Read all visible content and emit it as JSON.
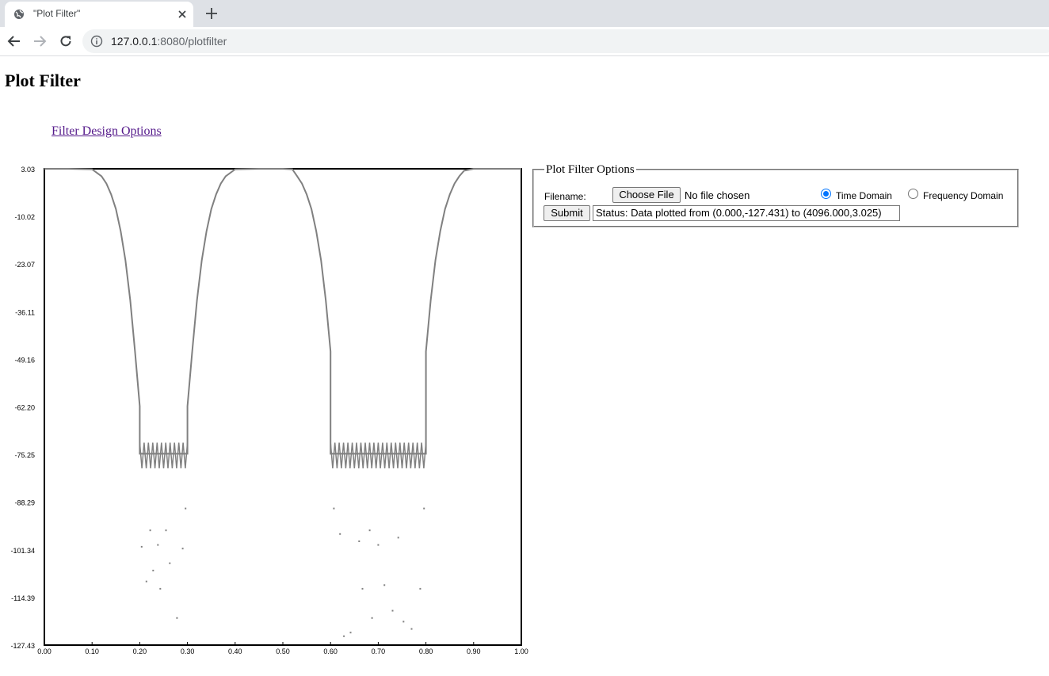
{
  "browser": {
    "tab_title": "\"Plot Filter\"",
    "url_host": "127.0.0.1",
    "url_rest": ":8080/plotfilter"
  },
  "page": {
    "title": "Plot Filter",
    "design_link": "Filter Design Options"
  },
  "options": {
    "legend": "Plot Filter Options",
    "filename_label": "Filename:",
    "choose_file_label": "Choose File",
    "no_file_text": "No file chosen",
    "time_domain_label": "Time Domain",
    "frequency_domain_label": "Frequency Domain",
    "selected_domain": "time",
    "submit_label": "Submit",
    "status_value": "Status: Data plotted from (0.000,-127.431) to (4096.000,3.025)"
  },
  "chart_data": {
    "type": "line",
    "xlim": [
      0.0,
      1.0
    ],
    "ylim": [
      -127.43,
      3.03
    ],
    "x_ticks": [
      "0.00",
      "0.10",
      "0.20",
      "0.30",
      "0.40",
      "0.50",
      "0.60",
      "0.70",
      "0.80",
      "0.90",
      "1.00"
    ],
    "y_ticks": [
      "3.03",
      "-10.02",
      "-23.07",
      "-36.11",
      "-49.16",
      "-62.20",
      "-75.25",
      "-88.29",
      "-101.34",
      "-114.39",
      "-127.43"
    ],
    "color": "#808080",
    "series": [
      {
        "x": [
          0.0,
          0.05,
          0.1,
          0.12,
          0.13,
          0.14,
          0.15,
          0.16,
          0.17,
          0.18,
          0.19,
          0.2,
          0.2,
          0.3,
          0.3,
          0.31,
          0.32,
          0.33,
          0.34,
          0.35,
          0.36,
          0.37,
          0.38,
          0.4,
          0.45,
          0.5,
          0.52,
          0.53,
          0.54,
          0.55,
          0.56,
          0.57,
          0.58,
          0.59,
          0.6,
          0.6,
          0.8,
          0.8,
          0.81,
          0.82,
          0.83,
          0.84,
          0.85,
          0.86,
          0.87,
          0.88,
          0.9,
          0.95,
          1.0
        ],
        "y": [
          3.03,
          3.03,
          2.9,
          1.0,
          -1.0,
          -4.0,
          -8.0,
          -14.0,
          -22.0,
          -33.0,
          -47.0,
          -62.0,
          -75.0,
          -75.0,
          -62.0,
          -47.0,
          -33.0,
          -22.0,
          -14.0,
          -8.0,
          -4.0,
          -1.0,
          1.0,
          2.9,
          3.03,
          3.03,
          2.9,
          1.0,
          -1.0,
          -4.0,
          -8.0,
          -14.0,
          -22.0,
          -33.0,
          -47.0,
          -75.0,
          -75.0,
          -47.0,
          -33.0,
          -22.0,
          -14.0,
          -8.0,
          -4.0,
          -1.0,
          1.0,
          2.5,
          3.03,
          3.03,
          3.03
        ]
      }
    ],
    "stopband_dips": [
      {
        "x": 0.204,
        "y": -100.5
      },
      {
        "x": 0.214,
        "y": -110.0
      },
      {
        "x": 0.222,
        "y": -96.0
      },
      {
        "x": 0.228,
        "y": -107.0
      },
      {
        "x": 0.238,
        "y": -100.0
      },
      {
        "x": 0.243,
        "y": -112.0
      },
      {
        "x": 0.255,
        "y": -96.0
      },
      {
        "x": 0.263,
        "y": -105.0
      },
      {
        "x": 0.278,
        "y": -120.0
      },
      {
        "x": 0.29,
        "y": -101.0
      },
      {
        "x": 0.296,
        "y": -90.0
      },
      {
        "x": 0.607,
        "y": -90.0
      },
      {
        "x": 0.62,
        "y": -97.0
      },
      {
        "x": 0.628,
        "y": -125.0
      },
      {
        "x": 0.642,
        "y": -124.0
      },
      {
        "x": 0.66,
        "y": -99.0
      },
      {
        "x": 0.667,
        "y": -112.0
      },
      {
        "x": 0.682,
        "y": -96.0
      },
      {
        "x": 0.687,
        "y": -120.0
      },
      {
        "x": 0.7,
        "y": -100.0
      },
      {
        "x": 0.713,
        "y": -111.0
      },
      {
        "x": 0.73,
        "y": -118.0
      },
      {
        "x": 0.742,
        "y": -98.0
      },
      {
        "x": 0.753,
        "y": -121.0
      },
      {
        "x": 0.77,
        "y": -123.0
      },
      {
        "x": 0.788,
        "y": -112.0
      },
      {
        "x": 0.796,
        "y": -90.0
      }
    ]
  }
}
